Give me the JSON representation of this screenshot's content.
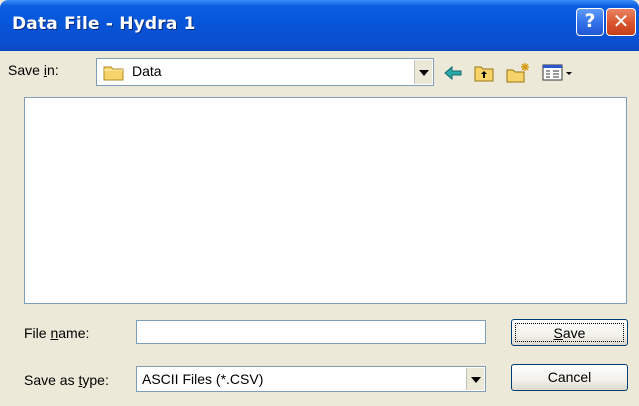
{
  "window": {
    "title": "Data File - Hydra 1",
    "help_glyph": "?",
    "close_glyph": "✕"
  },
  "save_in": {
    "label_pre": "Save ",
    "label_key": "i",
    "label_post": "n:",
    "value": "Data"
  },
  "toolbar": {
    "icons": [
      "back-arrow-icon",
      "up-one-level-icon",
      "new-folder-icon",
      "view-menu-icon"
    ]
  },
  "file_name": {
    "label_pre": "File ",
    "label_key": "n",
    "label_post": "ame:",
    "value": ""
  },
  "save_as_type": {
    "label_pre": "Save as ",
    "label_key": "t",
    "label_post": "ype:",
    "value": "ASCII Files (*.CSV)"
  },
  "buttons": {
    "save_key": "S",
    "save_rest": "ave",
    "cancel": "Cancel"
  },
  "colors": {
    "titlebar": "#0754d8",
    "dialog_bg": "#ece9d8",
    "field_border": "#7f9db9"
  }
}
